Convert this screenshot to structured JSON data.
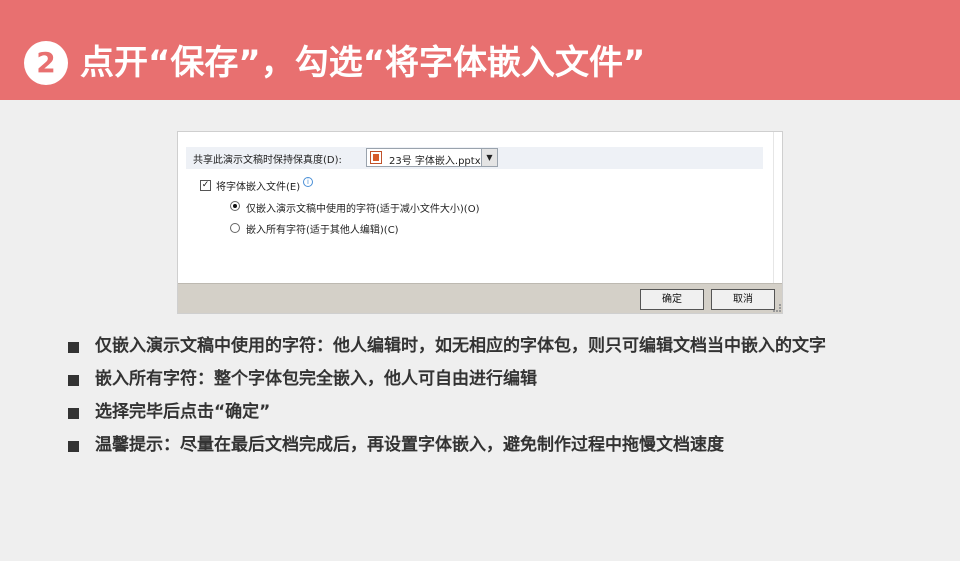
{
  "slide": {
    "step_number": "2",
    "title": "点开“保存”，勾选“将字体嵌入文件”"
  },
  "dialog": {
    "fidelity_label": "共享此演示文稿时保持保真度(D):",
    "file_name": "23号 字体嵌入.pptx",
    "embed_checkbox": {
      "label": "将字体嵌入文件(E)",
      "checked": true
    },
    "options": [
      {
        "label": "仅嵌入演示文稿中使用的字符(适于减小文件大小)(O)",
        "selected": true
      },
      {
        "label": "嵌入所有字符(适于其他人编辑)(C)",
        "selected": false
      }
    ],
    "ok_label": "确定",
    "cancel_label": "取消"
  },
  "bullets": [
    "仅嵌入演示文稿中使用的字符：他人编辑时，如无相应的字体包，则只可编辑文档当中嵌入的文字",
    "嵌入所有字符：整个字体包完全嵌入，他人可自由进行编辑",
    "选择完毕后点击“确定”",
    "温馨提示：尽量在最后文档完成后，再设置字体嵌入，避免制作过程中拖慢文档速度"
  ],
  "colors": {
    "banner": "#e87070",
    "background": "#efefef",
    "dialog_footer": "#d4d0c8"
  }
}
